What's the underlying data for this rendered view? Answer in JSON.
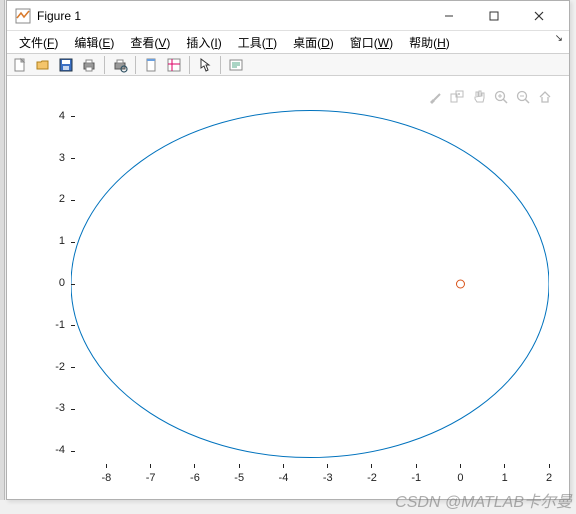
{
  "window": {
    "title": "Figure 1",
    "minimize": "—",
    "maximize": "▢",
    "close": "✕"
  },
  "menu": {
    "items": [
      {
        "label": "文件",
        "key": "F"
      },
      {
        "label": "编辑",
        "key": "E"
      },
      {
        "label": "查看",
        "key": "V"
      },
      {
        "label": "插入",
        "key": "I"
      },
      {
        "label": "工具",
        "key": "T"
      },
      {
        "label": "桌面",
        "key": "D"
      },
      {
        "label": "窗口",
        "key": "W"
      },
      {
        "label": "帮助",
        "key": "H"
      }
    ],
    "corner": "↘"
  },
  "toolbar": {
    "items": [
      "new",
      "open",
      "save",
      "print",
      "sep",
      "print-preview",
      "sep",
      "link",
      "layout",
      "sep",
      "arrow",
      "sep",
      "insert-text"
    ]
  },
  "axes_toolbar": [
    "brush",
    "data-tip",
    "pan",
    "zoom-in",
    "zoom-out",
    "home"
  ],
  "chart_data": {
    "type": "line",
    "title": "",
    "xlabel": "",
    "ylabel": "",
    "xlim": [
      -8.8,
      2
    ],
    "ylim": [
      -4.4,
      4.4
    ],
    "xticks": [
      -8,
      -7,
      -6,
      -5,
      -4,
      -3,
      -2,
      -1,
      0,
      1,
      2
    ],
    "yticks": [
      -4,
      -3,
      -2,
      -1,
      0,
      1,
      2,
      3,
      4
    ],
    "series": [
      {
        "name": "ellipse",
        "kind": "ellipse",
        "cx": -3.4,
        "cy": 0,
        "rx": 5.4,
        "ry": 4.15,
        "color": "#0072BD"
      },
      {
        "name": "focus",
        "kind": "marker",
        "x": [
          0
        ],
        "y": [
          0
        ],
        "marker": "o",
        "facecolor": "none",
        "edgecolor": "#D95319"
      }
    ]
  },
  "watermark": "CSDN @MATLAB卡尔曼"
}
